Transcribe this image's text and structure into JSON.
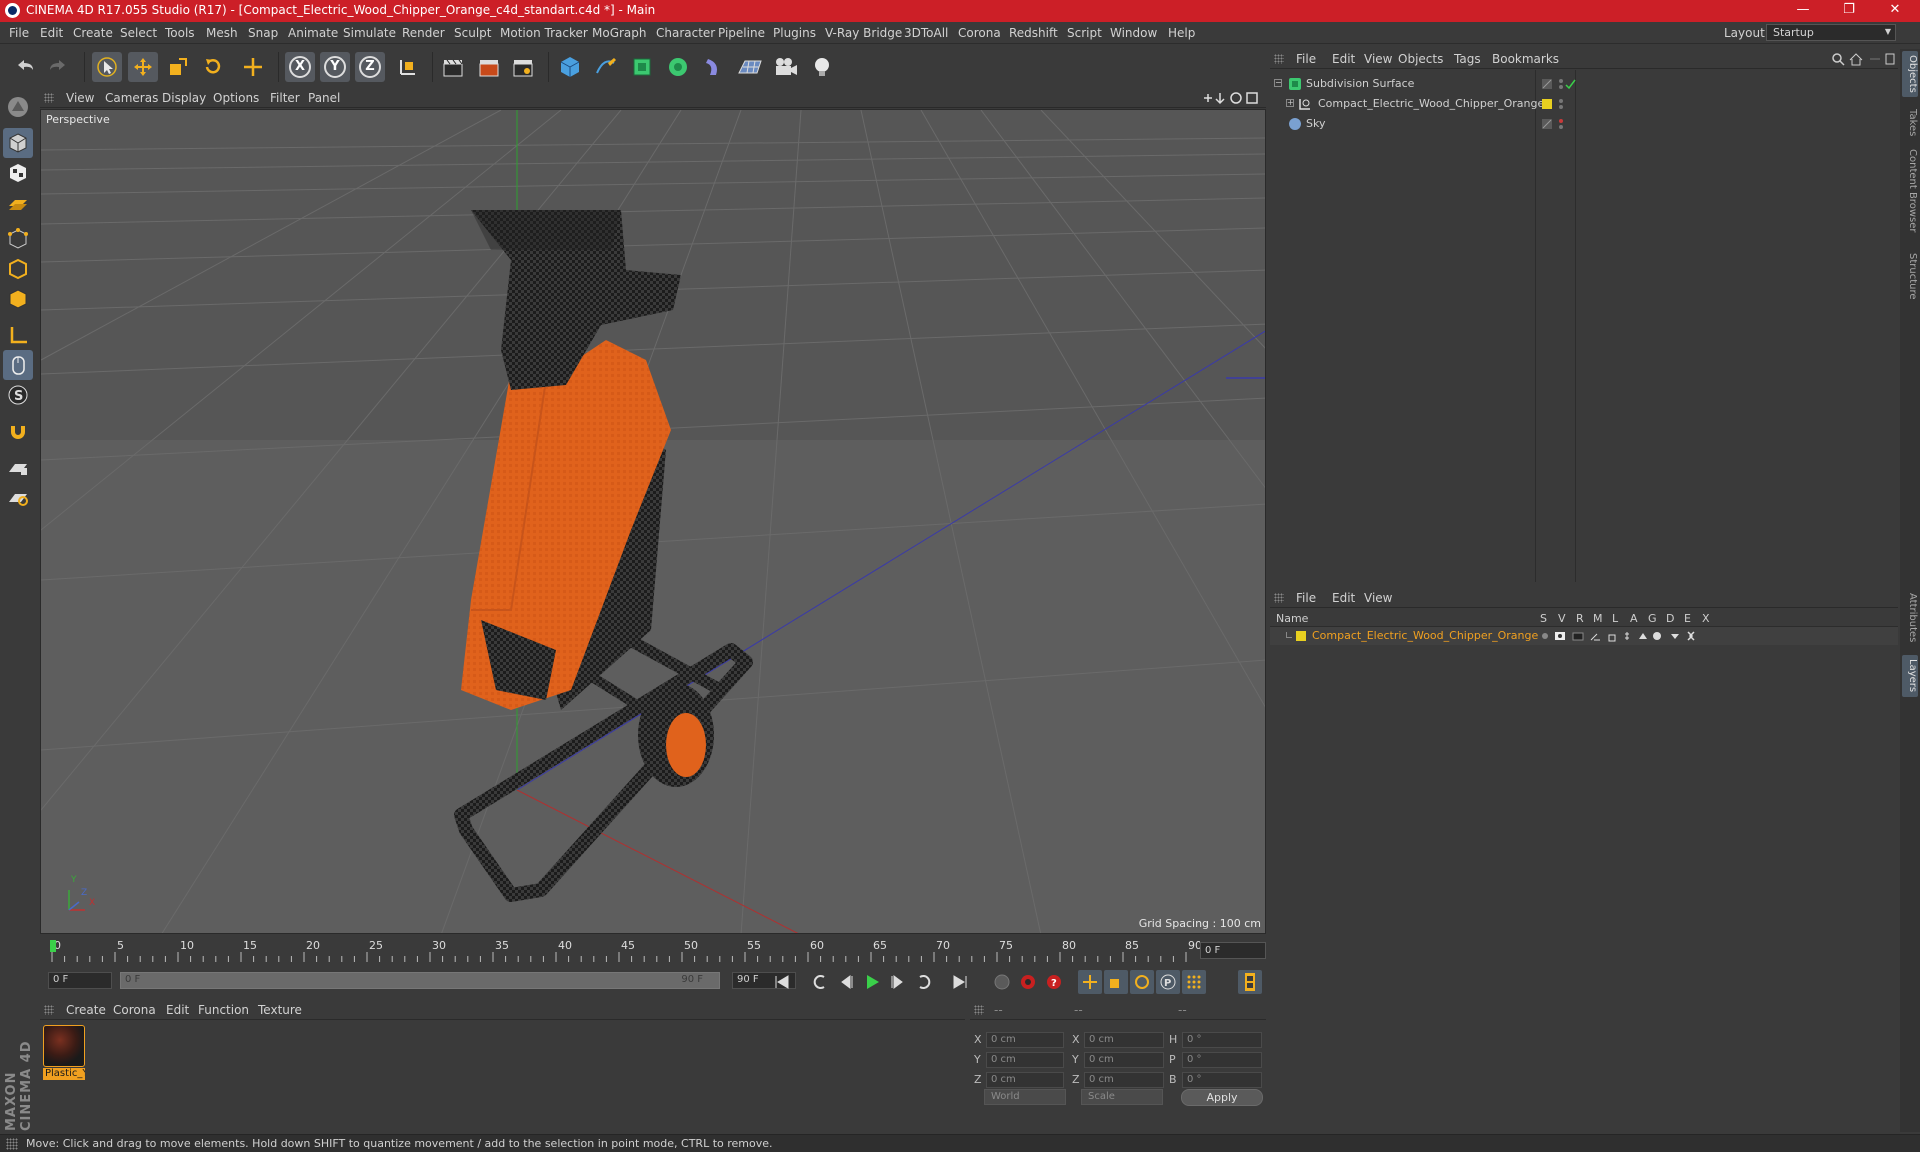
{
  "window": {
    "title": "CINEMA 4D R17.055 Studio (R17) - [Compact_Electric_Wood_Chipper_Orange_c4d_standart.c4d *] - Main",
    "minimize": "—",
    "maximize": "❐",
    "close": "✕"
  },
  "menubar": {
    "items": [
      "File",
      "Edit",
      "Create",
      "Select",
      "Tools",
      "Mesh",
      "Snap",
      "Animate",
      "Simulate",
      "Render",
      "Sculpt",
      "Motion Tracker",
      "MoGraph",
      "Character",
      "Pipeline",
      "Plugins",
      "V-Ray Bridge",
      "3DToAll",
      "Corona",
      "Redshift",
      "Script",
      "Window",
      "Help"
    ],
    "layout_label": "Layout:",
    "layout_value": "Startup"
  },
  "toolbar": {
    "axis_x": "X",
    "axis_y": "Y",
    "axis_z": "Z"
  },
  "viewport": {
    "menu": [
      "View",
      "Cameras",
      "Display",
      "Options",
      "Filter",
      "Panel"
    ],
    "label": "Perspective",
    "grid_spacing": "Grid Spacing : 100 cm",
    "axis_y": "Y",
    "axis_x": "X",
    "axis_z": "Z"
  },
  "timeline": {
    "ticks": [
      "0",
      "5",
      "10",
      "15",
      "20",
      "25",
      "30",
      "35",
      "40",
      "45",
      "50",
      "55",
      "60",
      "65",
      "70",
      "75",
      "80",
      "85",
      "90"
    ],
    "end_field": "0 F",
    "start_field": "0 F",
    "range_start": "0 F",
    "range_end": "90 F",
    "max_field": "90 F"
  },
  "material_manager": {
    "menu": [
      "Create",
      "Corona",
      "Edit",
      "Function",
      "Texture"
    ],
    "materials": [
      {
        "name": "Plastic_Y"
      }
    ]
  },
  "coordinates": {
    "header": [
      "--",
      "--",
      "--"
    ],
    "rows": [
      {
        "axis": "X",
        "pos": "0 cm",
        "axis2": "X",
        "size": "0 cm",
        "rot_label": "H",
        "rot": "0 °"
      },
      {
        "axis": "Y",
        "pos": "0 cm",
        "axis2": "Y",
        "size": "0 cm",
        "rot_label": "P",
        "rot": "0 °"
      },
      {
        "axis": "Z",
        "pos": "0 cm",
        "axis2": "Z",
        "size": "0 cm",
        "rot_label": "B",
        "rot": "0 °"
      }
    ],
    "mode1": "World",
    "mode2": "Scale",
    "apply": "Apply"
  },
  "object_manager": {
    "menu": [
      "File",
      "Edit",
      "View",
      "Objects",
      "Tags",
      "Bookmarks"
    ],
    "objects": [
      {
        "name": "Subdivision Surface"
      },
      {
        "name": "Compact_Electric_Wood_Chipper_Orange"
      },
      {
        "name": "Sky"
      }
    ]
  },
  "layer_manager": {
    "menu": [
      "File",
      "Edit",
      "View"
    ],
    "columns": [
      "Name",
      "S",
      "V",
      "R",
      "M",
      "L",
      "A",
      "G",
      "D",
      "E",
      "X"
    ],
    "layers": [
      {
        "name": "Compact_Electric_Wood_Chipper_Orange"
      }
    ]
  },
  "side_tabs": [
    "Objects",
    "Takes",
    "Content Browser",
    "Structure",
    "Attributes",
    "Layers"
  ],
  "status": "Move: Click and drag to move elements. Hold down SHIFT to quantize movement / add to the selection in point mode, CTRL to remove.",
  "colors": {
    "titlebar": "#cc1f27",
    "accent_orange": "#f0a020",
    "selection_blue": "#5a6c82"
  }
}
